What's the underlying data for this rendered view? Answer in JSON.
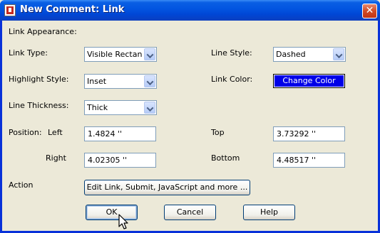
{
  "window": {
    "title": "New Comment: Link",
    "close_glyph": "✕"
  },
  "section_label": "Link Appearance:",
  "link_type": {
    "label": "Link Type:",
    "value": "Visible Rectangl"
  },
  "highlight_style": {
    "label": "Highlight Style:",
    "value": "Inset"
  },
  "line_thickness": {
    "label": "Line Thickness:",
    "value": "Thick"
  },
  "line_style": {
    "label": "Line Style:",
    "value": "Dashed"
  },
  "link_color": {
    "label": "Link Color:",
    "button": "Change Color",
    "color": "#0000e8"
  },
  "position": {
    "label": "Position:",
    "left_label": "Left",
    "left_value": "1.4824 ''",
    "right_label": "Right",
    "right_value": "4.02305 ''",
    "top_label": "Top",
    "top_value": "3.73292 ''",
    "bottom_label": "Bottom",
    "bottom_value": "4.48517 ''"
  },
  "action": {
    "label": "Action",
    "button": "Edit Link, Submit, JavaScript and more ..."
  },
  "buttons": {
    "ok": "OK",
    "cancel": "Cancel",
    "help": "Help"
  },
  "icons": [
    "app-icon",
    "close-icon",
    "dropdown-arrow-icon",
    "mouse-pointer-icon"
  ]
}
